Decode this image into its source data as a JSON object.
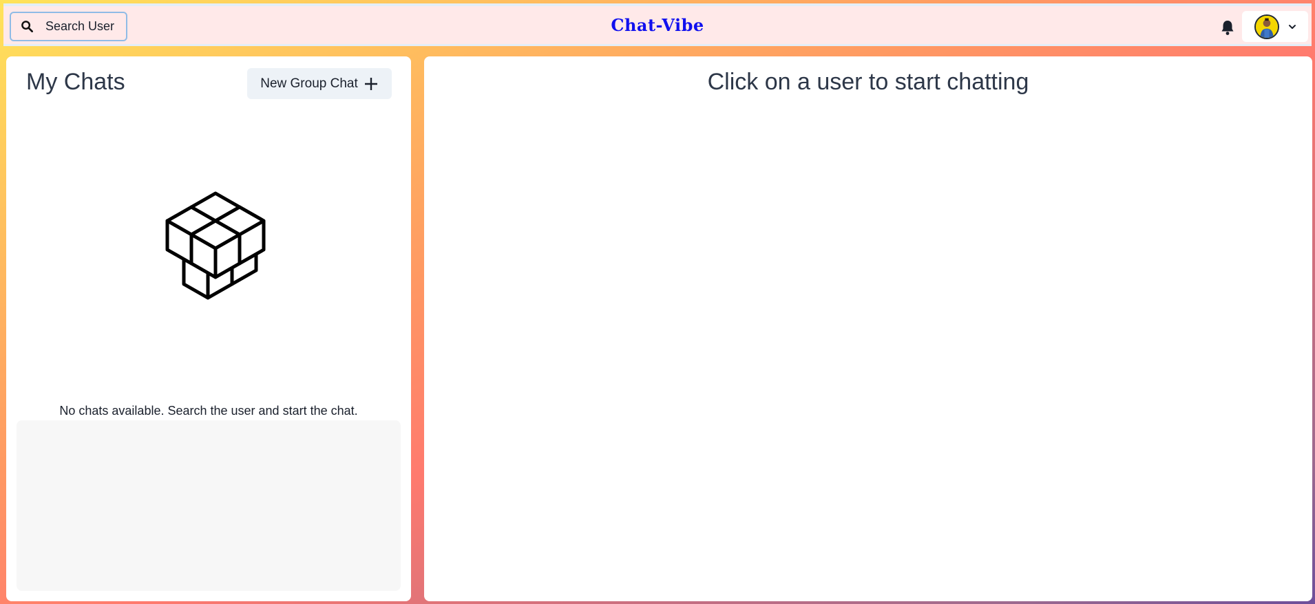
{
  "header": {
    "search_label": "Search User",
    "app_title": "Chat-Vibe",
    "notification_icon": "bell-icon",
    "profile_icon": "avatar",
    "profile_menu_icon": "chevron-down-icon"
  },
  "chats_panel": {
    "title": "My Chats",
    "new_group_label": "New Group Chat",
    "new_group_icon": "plus-icon",
    "illustration": "cubes-icon",
    "empty_message": "No chats available. Search the user and start the chat."
  },
  "chat_area": {
    "prompt": "Click on a user to start chatting"
  },
  "colors": {
    "title": "#1010ee",
    "header_bg": "#ffe9e9",
    "button_bg": "#edf2f7"
  }
}
